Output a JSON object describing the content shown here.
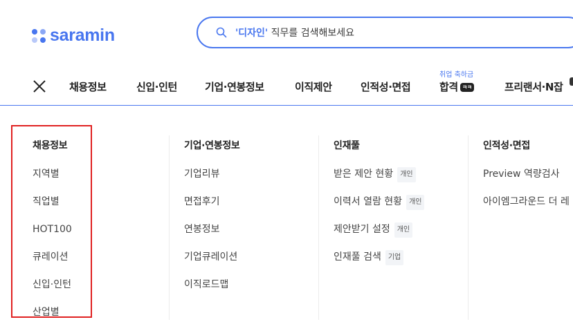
{
  "header": {
    "logo_text": "saramin",
    "logo_dot_colors": [
      "#4876ef",
      "#8aa7f5",
      "#b9c9f9",
      "#4876ef"
    ],
    "search": {
      "placeholder_highlight": "'디자인'",
      "placeholder_rest": " 직무를 검색해보세요"
    }
  },
  "nav": {
    "items": [
      "채용정보",
      "신입·인턴",
      "기업·연봉정보",
      "이직제안",
      "인적성·면접",
      "합격",
      "프리랜서·N잡"
    ],
    "hapgyeok_sub": "취업 축하금",
    "hapgyeok_badge": "ㅋㅋ"
  },
  "menu": {
    "columns": [
      {
        "title": "채용정보",
        "items": [
          {
            "label": "지역별"
          },
          {
            "label": "직업별"
          },
          {
            "label": "HOT100"
          },
          {
            "label": "큐레이션"
          },
          {
            "label": "신입·인턴"
          },
          {
            "label": "산업별"
          }
        ]
      },
      {
        "title": "기업·연봉정보",
        "items": [
          {
            "label": "기업리뷰"
          },
          {
            "label": "면접후기"
          },
          {
            "label": "연봉정보"
          },
          {
            "label": "기업큐레이션"
          },
          {
            "label": "이직로드맵"
          }
        ]
      },
      {
        "title": "인재풀",
        "items": [
          {
            "label": "받은 제안 현황",
            "tag": "개인"
          },
          {
            "label": "이력서 열람 현황",
            "tag": "개인"
          },
          {
            "label": "제안받기 설정",
            "tag": "개인"
          },
          {
            "label": "인재풀 검색",
            "tag": "기업"
          }
        ]
      },
      {
        "title": "인적성·면접",
        "items": [
          {
            "label": "Preview 역량검사"
          },
          {
            "label": "아이엠그라운드 더 레"
          }
        ]
      }
    ]
  },
  "colors": {
    "brand": "#4876ef",
    "highlight_border": "#e02020"
  }
}
